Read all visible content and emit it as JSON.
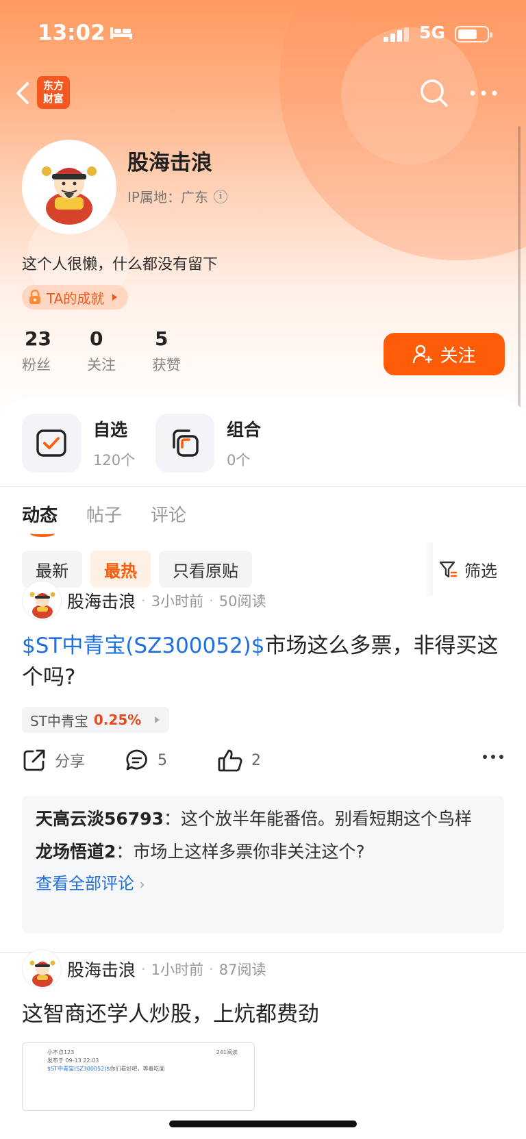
{
  "status_bar": {
    "time": "13:02",
    "network": "5G"
  },
  "nav": {
    "logo_line1": "东方",
    "logo_line2": "财富"
  },
  "profile": {
    "name": "股海击浪",
    "ip_location": "IP属地：广东",
    "bio": "这个人很懒，什么都没有留下",
    "achievement_label": "TA的成就",
    "stats": [
      {
        "value": "23",
        "label": "粉丝"
      },
      {
        "value": "0",
        "label": "关注"
      },
      {
        "value": "5",
        "label": "获赞"
      }
    ],
    "follow_label": "关注"
  },
  "shortcuts": [
    {
      "title": "自选",
      "sub": "120个"
    },
    {
      "title": "组合",
      "sub": "0个"
    }
  ],
  "tabs": [
    {
      "label": "动态",
      "active": true
    },
    {
      "label": "帖子",
      "active": false
    },
    {
      "label": "评论",
      "active": false
    }
  ],
  "filters": [
    {
      "label": "最新",
      "active": false
    },
    {
      "label": "最热",
      "active": true
    },
    {
      "label": "只看原贴",
      "active": false
    }
  ],
  "filter_button_label": "筛选",
  "posts": [
    {
      "author": "股海击浪",
      "time": "3小时前",
      "reads": "50阅读",
      "stock_mention": "$ST中青宝(SZ300052)$",
      "text": "市场这么多票，非得买这个吗?",
      "stock_tag": {
        "name": "ST中青宝",
        "change": "0.25%"
      },
      "share_label": "分享",
      "comment_count": "5",
      "like_count": "2",
      "comments": [
        {
          "user": "天高云淡56793",
          "text": "这个放半年能番倍。别看短期这个鸟样"
        },
        {
          "user": "龙场悟道2",
          "text": "市场上这样多票你非关注这个?"
        }
      ],
      "view_all_label": "查看全部评论"
    },
    {
      "author": "股海击浪",
      "time": "1小时前",
      "reads": "87阅读",
      "text": "这智商还学人炒股，上炕都费劲",
      "thumb": {
        "user": "小不点123",
        "meta": "发布于 09-13 22:03",
        "views": "241阅读",
        "mention": "$ST中青宝(SZ300052)$",
        "text": "你们看好吧，等着吃面"
      }
    }
  ],
  "colors": {
    "accent": "#ff5c0a",
    "link": "#1e6fe0",
    "up": "#e8481e"
  }
}
